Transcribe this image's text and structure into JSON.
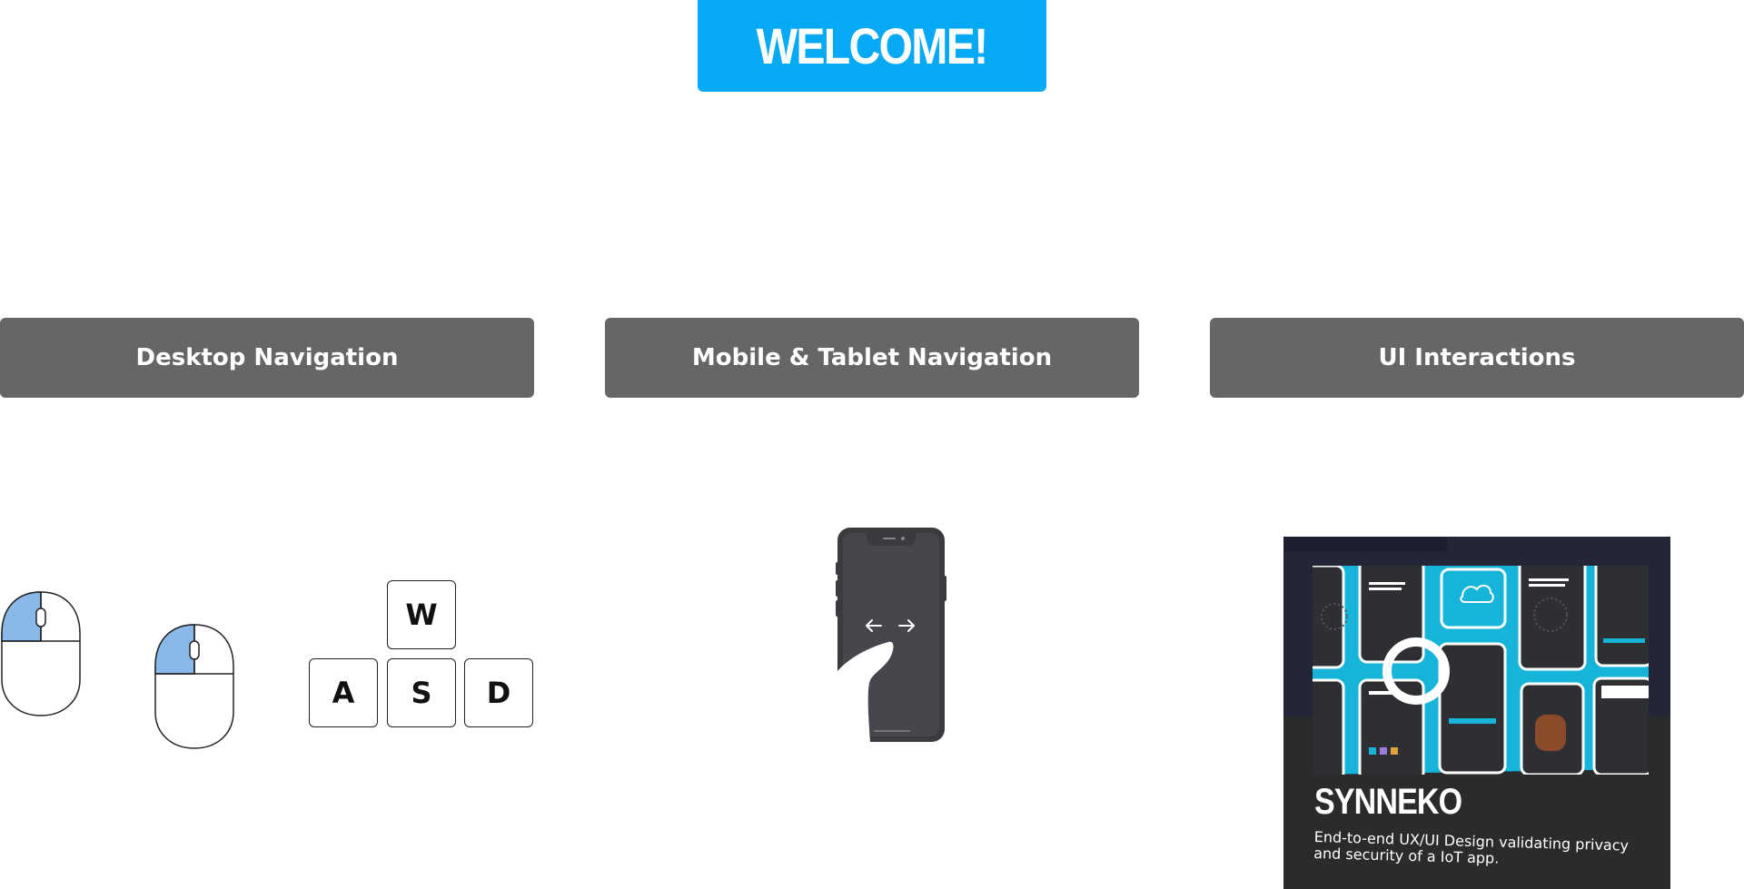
{
  "header": {
    "welcome_label": "WELCOME!",
    "accent_color": "#05a9f4"
  },
  "sections": [
    {
      "label": "Desktop Navigation"
    },
    {
      "label": "Mobile & Tablet Navigation"
    },
    {
      "label": "UI Interactions"
    }
  ],
  "section_color": "#666666",
  "desktop": {
    "keys": [
      "W",
      "A",
      "S",
      "D"
    ],
    "mouse_highlight_color": "#8ab8e8"
  },
  "mobile": {
    "icon": "phone-swipe-icon"
  },
  "project": {
    "title": "SYNNEKO",
    "description": "End-to-end UX/UI Design validating privacy and security of a IoT app.",
    "accent_color": "#16b4d8"
  }
}
